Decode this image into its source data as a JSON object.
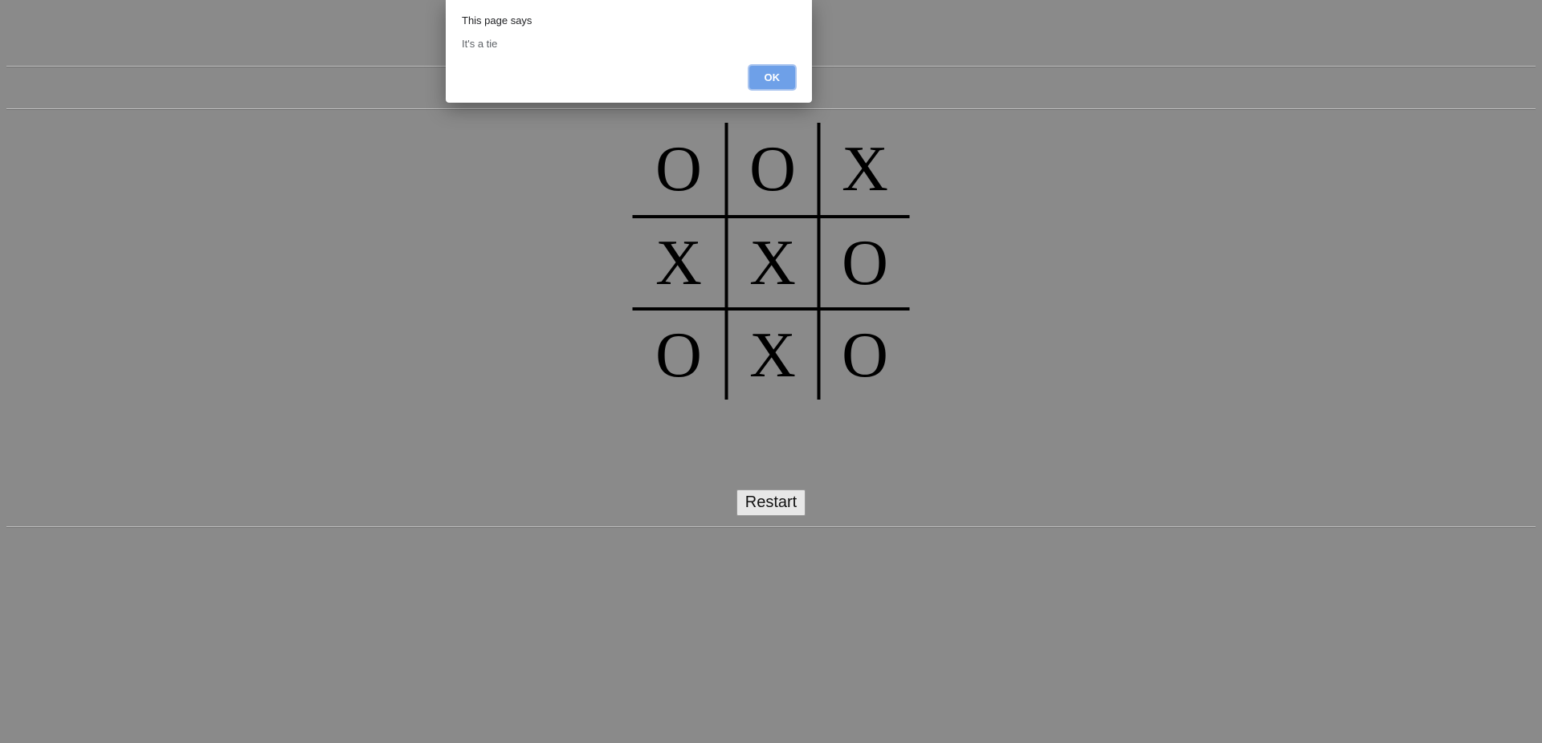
{
  "dialog": {
    "title": "This page says",
    "message": "It's a tie",
    "ok_label": "OK"
  },
  "board": {
    "cells": [
      "O",
      "O",
      "X",
      "X",
      "X",
      "O",
      "O",
      "X",
      "O"
    ]
  },
  "controls": {
    "restart_label": "Restart"
  }
}
